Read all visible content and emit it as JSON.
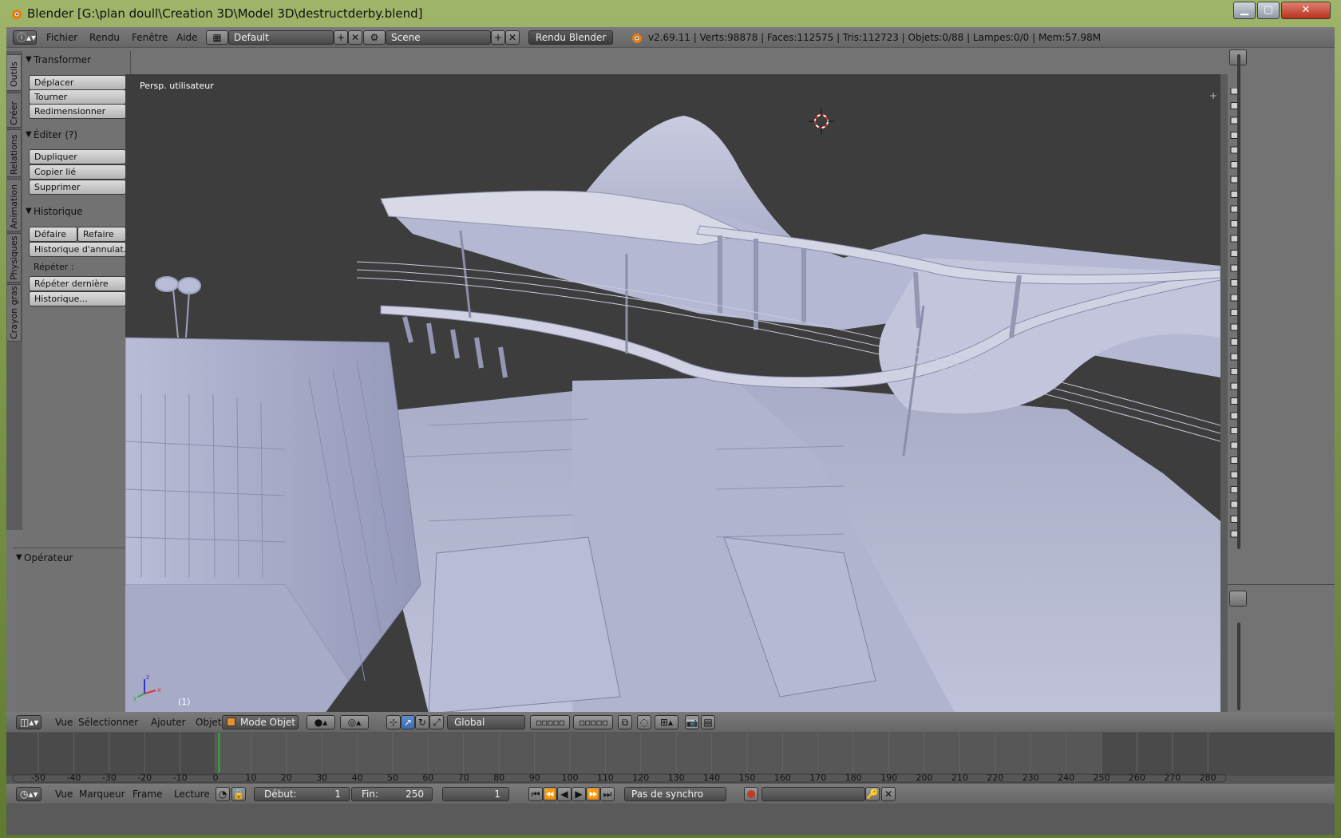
{
  "window": {
    "title": "Blender [G:\\plan doull\\Creation 3D\\Model 3D\\destructderby.blend]"
  },
  "colors": {
    "accent": "#4a90d9",
    "viewport_bg": "#3d3d3d",
    "mesh": "#b3b6cf",
    "current_frame_line": "#2fb82f",
    "record_red": "#c0392b"
  },
  "info_header": {
    "menus": [
      "Fichier",
      "Rendu",
      "Fenêtre",
      "Aide"
    ],
    "screen_layout": "Default",
    "scene": "Scene",
    "render_engine": "Rendu Blender",
    "stats": "v2.69.11 | Verts:98878 | Faces:112575 | Tris:112723 | Objets:0/88 | Lampes:0/0 | Mem:57.98M"
  },
  "tool_tabs": [
    "Outils",
    "Créer",
    "Relations",
    "Animation",
    "Physiques",
    "Crayon gras"
  ],
  "toolshelf": {
    "transform": {
      "title": "Transformer",
      "buttons": [
        "Déplacer",
        "Tourner",
        "Redimensionner"
      ]
    },
    "edit": {
      "title": "Éditer (?)",
      "buttons": [
        "Dupliquer",
        "Copier lié",
        "Supprimer"
      ]
    },
    "history": {
      "title": "Historique",
      "undo": "Défaire",
      "redo": "Refaire",
      "undo_history": "Historique d'annulat...",
      "repeat_label": "Répéter :",
      "repeat_last": "Répéter dernière",
      "history": "Historique..."
    },
    "operator": {
      "title": "Opérateur"
    }
  },
  "viewport": {
    "view_label": "Persp. utilisateur",
    "frame": "(1)"
  },
  "view3d_header": {
    "menus": [
      "Vue",
      "Sélectionner",
      "Ajouter",
      "Objet"
    ],
    "mode": "Mode Objet",
    "orientation": "Global"
  },
  "timeline": {
    "ticks": [
      "-50",
      "-40",
      "-30",
      "-20",
      "-10",
      "0",
      "10",
      "20",
      "30",
      "40",
      "50",
      "60",
      "70",
      "80",
      "90",
      "100",
      "110",
      "120",
      "130",
      "140",
      "150",
      "160",
      "170",
      "180",
      "190",
      "200",
      "210",
      "220",
      "230",
      "240",
      "250",
      "260",
      "270",
      "280"
    ],
    "current_frame": 1,
    "start": "Début:",
    "start_value": "1",
    "end": "Fin:",
    "end_value": "250",
    "frame_value": "1",
    "menus": [
      "Vue",
      "Marqueur",
      "Frame",
      "Lecture"
    ],
    "sync": "Pas de synchro"
  }
}
